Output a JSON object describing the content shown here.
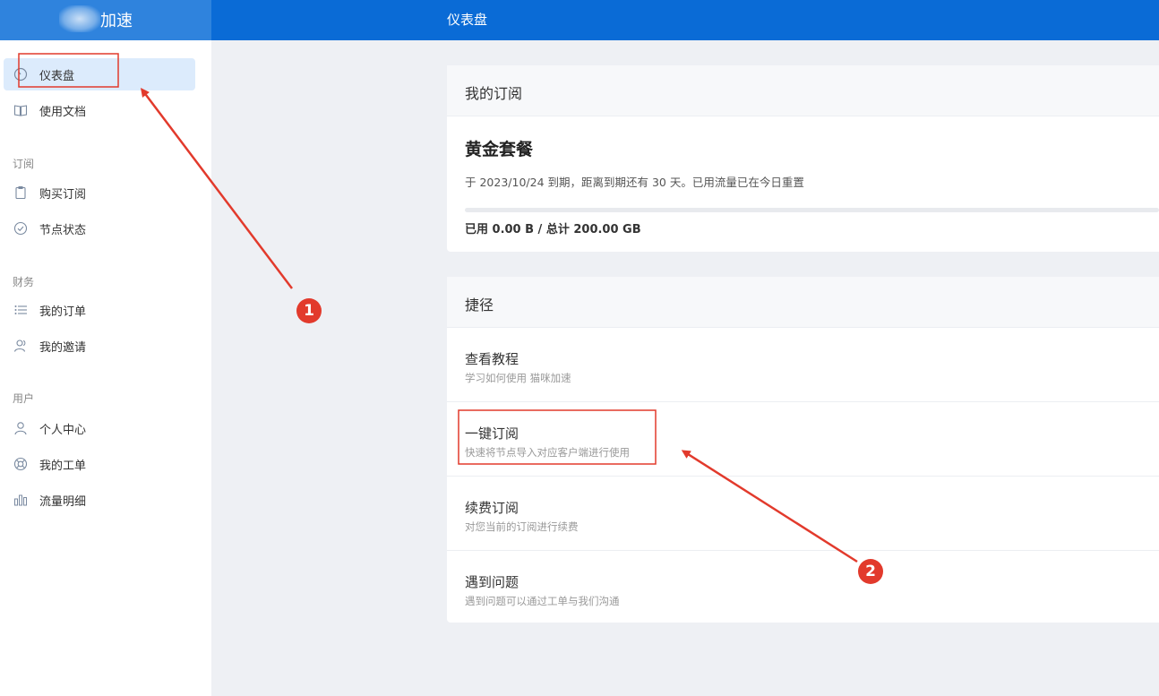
{
  "brand": {
    "name": "加速"
  },
  "header": {
    "title": "仪表盘"
  },
  "sidebar": {
    "items": [
      {
        "label": "仪表盘",
        "icon": "dashboard-icon"
      },
      {
        "label": "使用文档",
        "icon": "book-icon"
      }
    ],
    "groups": [
      {
        "title": "订阅",
        "items": [
          {
            "label": "购买订阅",
            "icon": "clipboard-icon"
          },
          {
            "label": "节点状态",
            "icon": "check-circle-icon"
          }
        ]
      },
      {
        "title": "财务",
        "items": [
          {
            "label": "我的订单",
            "icon": "list-icon"
          },
          {
            "label": "我的邀请",
            "icon": "users-icon"
          }
        ]
      },
      {
        "title": "用户",
        "items": [
          {
            "label": "个人中心",
            "icon": "user-icon"
          },
          {
            "label": "我的工单",
            "icon": "lifebuoy-icon"
          },
          {
            "label": "流量明细",
            "icon": "bar-chart-icon"
          }
        ]
      }
    ]
  },
  "subscription": {
    "header": "我的订阅",
    "plan_name": "黄金套餐",
    "expire_text": "于 2023/10/24 到期，距离到期还有 30 天。已用流量已在今日重置",
    "usage_text": "已用 0.00 B / 总计 200.00 GB",
    "usage_fraction": 0
  },
  "shortcuts": {
    "header": "捷径",
    "items": [
      {
        "title": "查看教程",
        "desc": "学习如何使用 猫咪加速"
      },
      {
        "title": "一键订阅",
        "desc": "快速将节点导入对应客户端进行使用"
      },
      {
        "title": "续费订阅",
        "desc": "对您当前的订阅进行续费"
      },
      {
        "title": "遇到问题",
        "desc": "遇到问题可以通过工单与我们沟通"
      }
    ]
  },
  "annotations": {
    "marker1": "1",
    "marker2": "2",
    "color": "#e23a2c"
  },
  "colors": {
    "primary": "#0a6bd6",
    "active_bg": "#dcebfc"
  }
}
